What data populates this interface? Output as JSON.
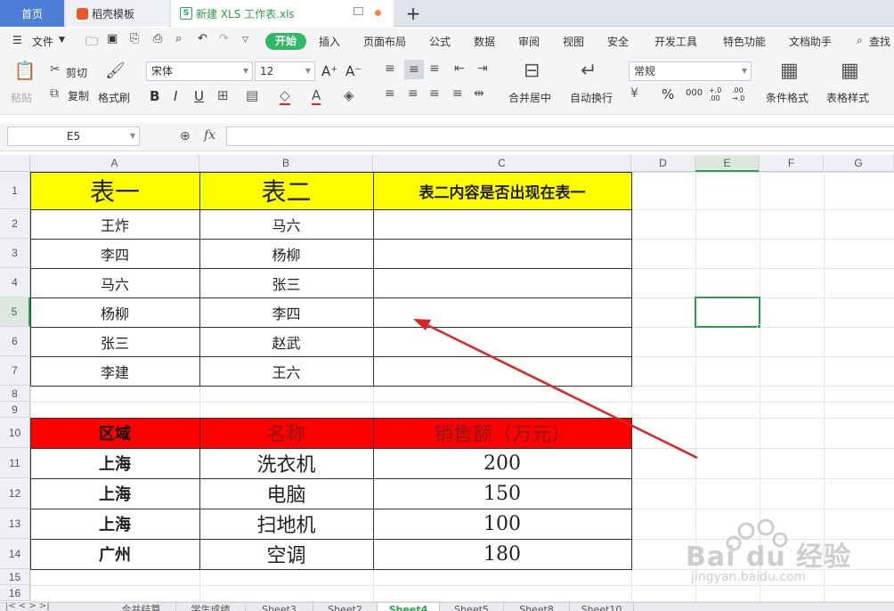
{
  "tabs": {
    "home": "首页",
    "docer": "稻壳模板",
    "file": "新建 XLS 工作表.xls",
    "new_tab": "+"
  },
  "menubar": {
    "file": "文件",
    "items": [
      "开始",
      "插入",
      "页面布局",
      "公式",
      "数据",
      "审阅",
      "视图",
      "安全",
      "开发工具",
      "特色功能",
      "文档助手"
    ],
    "search": "查找"
  },
  "ribbon": {
    "paste": "粘贴",
    "cut": "剪切",
    "copy": "复制",
    "format_painter": "格式刷",
    "font": "宋体",
    "size": "12",
    "merge_center": "合并居中",
    "wrap": "自动换行",
    "number_format": "常规",
    "conditional": "条件格式",
    "table_style": "表格样式",
    "bold": "B",
    "italic": "I",
    "underline": "U",
    "grow": "A⁺",
    "shrink": "A⁻",
    "percent": "%",
    "thousand": "000",
    "dec_add": "+.0 .00",
    "dec_sub": ".00 →.0"
  },
  "formula_bar": {
    "cell_ref": "E5",
    "fx": "fx",
    "content": ""
  },
  "columns": [
    "A",
    "B",
    "C",
    "D",
    "E",
    "F",
    "G"
  ],
  "rows": [
    "1",
    "2",
    "3",
    "4",
    "5",
    "6",
    "7",
    "8",
    "9",
    "10",
    "11",
    "12",
    "13",
    "14",
    "15",
    "16"
  ],
  "selected": {
    "column": "E",
    "row": "5"
  },
  "table1": {
    "headers": [
      "表一",
      "表二",
      "表二内容是否出现在表一"
    ],
    "rows": [
      [
        "王炸",
        "马六",
        ""
      ],
      [
        "李四",
        "杨柳",
        ""
      ],
      [
        "马六",
        "张三",
        ""
      ],
      [
        "杨柳",
        "李四",
        ""
      ],
      [
        "张三",
        "赵武",
        ""
      ],
      [
        "李建",
        "王六",
        ""
      ]
    ],
    "header_bg": "#ffff00"
  },
  "table2": {
    "headers": [
      "区域",
      "名称",
      "销售额（万元）"
    ],
    "rows": [
      [
        "上海",
        "洗衣机",
        "200"
      ],
      [
        "上海",
        "电脑",
        "150"
      ],
      [
        "上海",
        "扫地机",
        "100"
      ],
      [
        "广州",
        "空调",
        "180"
      ]
    ],
    "header_bg": "#ff0000"
  },
  "sheets": [
    "合并结算",
    "学生成绩",
    "Sheet3",
    "Sheet2",
    "Sheet4",
    "Sheet5",
    "Sheet8",
    "Sheet10"
  ],
  "active_sheet": "Sheet4",
  "watermark": {
    "brand": "Bai du 经验",
    "url": "jingyan.baidu.com"
  },
  "colors": {
    "accent": "#2fb865",
    "arrow": "#dd2222",
    "selection": "#2e9f4f"
  }
}
